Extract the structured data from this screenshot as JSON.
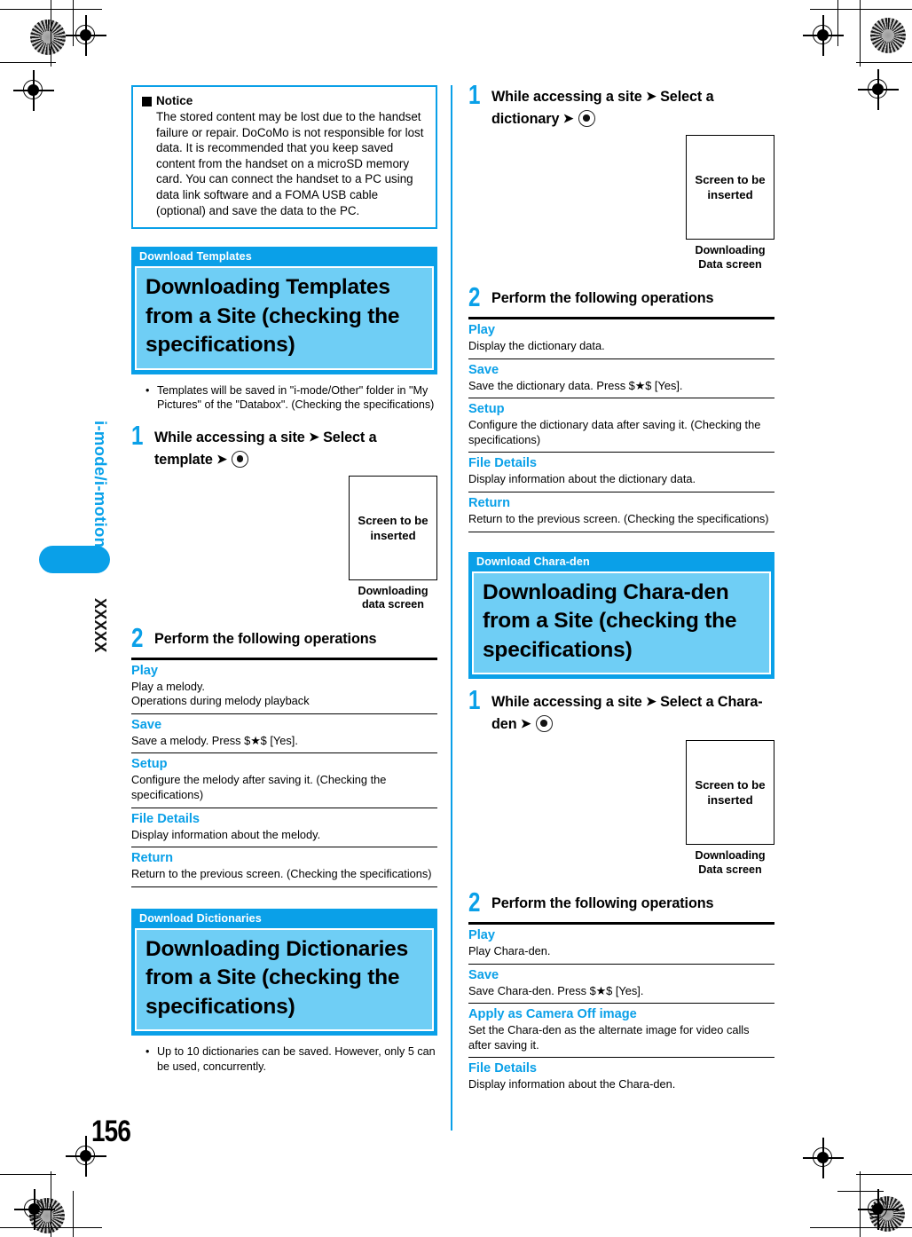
{
  "page": {
    "number": "156",
    "chapter_rail": "i-mode/i-motion",
    "rail_code": "XXXXX"
  },
  "notice": {
    "heading": "Notice",
    "body": "The stored content may be lost due to the handset failure or repair. DoCoMo is not responsible for lost data. It is recommended that you keep saved content from the handset on a microSD memory card. You can connect the handset to a PC using data link software and a FOMA USB cable (optional) and save the data to the PC."
  },
  "sections": {
    "templates": {
      "label": "Download Templates",
      "title": "Downloading Templates from a Site (checking the specifications)",
      "bullets": [
        "Templates will be saved in \"i-mode/Other\" folder in \"My Pictures\" of the \"Databox\". (Checking the specifications)"
      ],
      "step1": {
        "number": "1",
        "text_a": "While accessing a site",
        "arrow": "❯",
        "text_b": "Select a template",
        "arrow2": "❯"
      },
      "figure": {
        "box_text": "Screen to be inserted",
        "caption": "Downloading data screen"
      },
      "step2": {
        "number": "2",
        "text": "Perform the following operations"
      },
      "operations": [
        {
          "title": "Play",
          "desc": "Play a melody.\nOperations during melody playback"
        },
        {
          "title": "Save",
          "desc": "Save a melody. Press $★$ [Yes]."
        },
        {
          "title": "Setup",
          "desc": "Configure the melody after saving it. (Checking the specifications)"
        },
        {
          "title": "File Details",
          "desc": "Display information about the melody."
        },
        {
          "title": "Return",
          "desc": "Return to the previous screen. (Checking the specifications)"
        }
      ]
    },
    "dictionaries": {
      "label": "Download Dictionaries",
      "title": "Downloading Dictionaries from a Site (checking the specifications)",
      "bullets": [
        "Up to 10 dictionaries can be saved. However, only 5 can be used, concurrently."
      ],
      "step1": {
        "number": "1",
        "text_a": "While accessing a site",
        "arrow": "❯",
        "text_b": "Select a dictionary",
        "arrow2": "❯"
      },
      "figure": {
        "box_text": "Screen to be inserted",
        "caption": "Downloading Data screen"
      },
      "step2": {
        "number": "2",
        "text": "Perform the following operations"
      },
      "operations": [
        {
          "title": "Play",
          "desc": "Display the dictionary data."
        },
        {
          "title": "Save",
          "desc": "Save the dictionary data. Press $★$ [Yes]."
        },
        {
          "title": "Setup",
          "desc": "Configure the dictionary data after saving it. (Checking the specifications)"
        },
        {
          "title": "File Details",
          "desc": "Display information about the dictionary data."
        },
        {
          "title": "Return",
          "desc": "Return to the previous screen. (Checking the specifications)"
        }
      ]
    },
    "charaden": {
      "label": "Download Chara-den",
      "title": "Downloading Chara-den from a Site (checking the specifications)",
      "step1": {
        "number": "1",
        "text_a": "While accessing a site",
        "arrow": "❯",
        "text_b": "Select a Chara-den",
        "arrow2": "❯"
      },
      "figure": {
        "box_text": "Screen to be inserted",
        "caption": "Downloading Data screen"
      },
      "step2": {
        "number": "2",
        "text": "Perform the following operations"
      },
      "operations": [
        {
          "title": "Play",
          "desc": "Play Chara-den."
        },
        {
          "title": "Save",
          "desc": "Save Chara-den. Press $★$ [Yes]."
        },
        {
          "title": "Apply as Camera Off image",
          "desc": "Set the Chara-den as the alternate image for video calls after saving it."
        },
        {
          "title": "File Details",
          "desc": "Display information about the Chara-den."
        }
      ]
    }
  },
  "colors": {
    "accent_blue": "#0aa0e8",
    "title_fill": "#6fcef5",
    "text_black": "#000000"
  }
}
